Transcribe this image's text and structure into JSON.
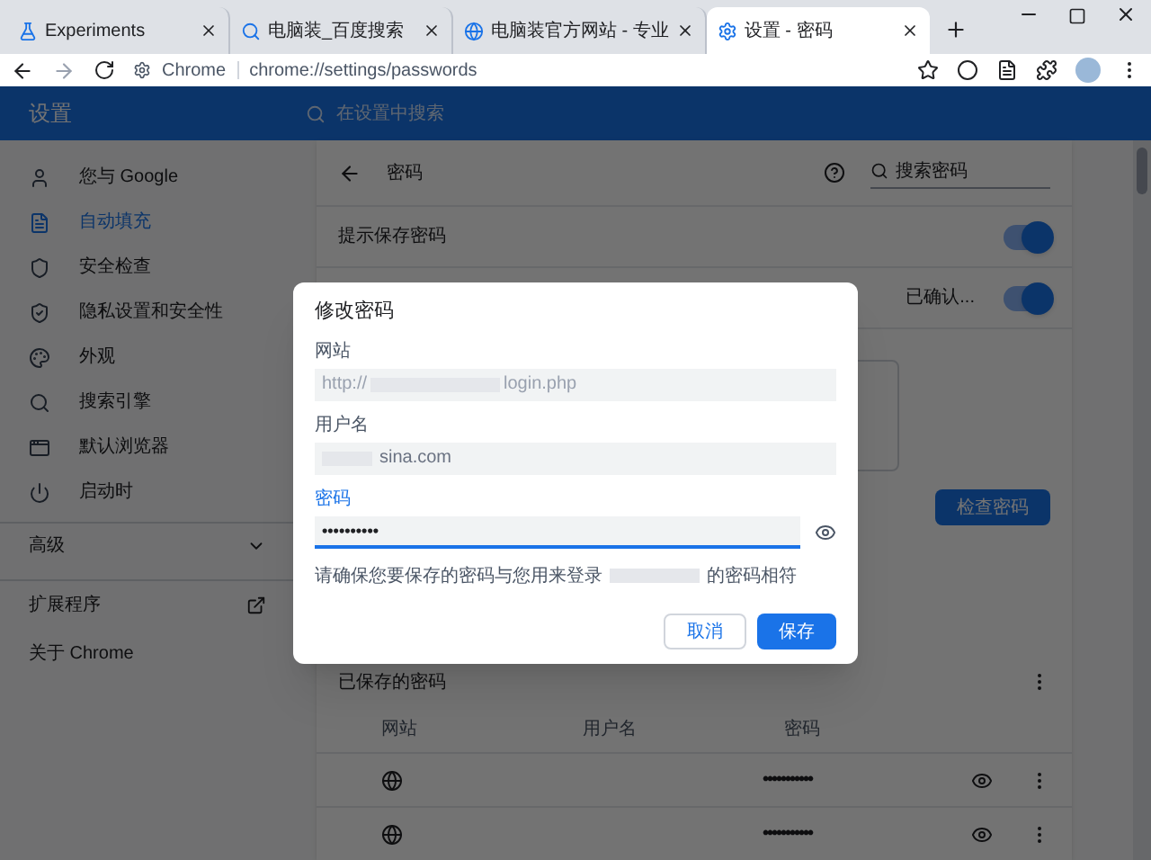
{
  "tabs": [
    {
      "title": "Experiments",
      "selected": false
    },
    {
      "title": "电脑装_百度搜索",
      "selected": false
    },
    {
      "title": "电脑装官方网站 - 专业",
      "selected": false
    },
    {
      "title": "设置 - 密码",
      "selected": true
    }
  ],
  "address_bar": {
    "origin": "Chrome",
    "url": "chrome://settings/passwords"
  },
  "header": {
    "title": "设置",
    "search_placeholder": "在设置中搜索"
  },
  "sidebar": {
    "items": [
      {
        "label": "您与 Google",
        "selected": false
      },
      {
        "label": "自动填充",
        "selected": true
      },
      {
        "label": "安全检查",
        "selected": false
      },
      {
        "label": "隐私设置和安全性",
        "selected": false
      },
      {
        "label": "外观",
        "selected": false
      },
      {
        "label": "搜索引擎",
        "selected": false
      },
      {
        "label": "默认浏览器",
        "selected": false
      },
      {
        "label": "启动时",
        "selected": false
      }
    ],
    "advanced": {
      "label": "高级",
      "expanded": false
    },
    "extensions": "扩展程序",
    "about": "关于 Chrome"
  },
  "passwords": {
    "title": "密码",
    "search_placeholder": "搜索密码",
    "settings": [
      {
        "label": "提示保存密码",
        "on": true
      },
      {
        "label": "已确认...",
        "on": true
      }
    ],
    "check_button": "检查密码",
    "saved_title": "已保存的密码",
    "columns": [
      "网站",
      "用户名",
      "密码"
    ],
    "rows": [
      {
        "password": "•••••••••••"
      },
      {
        "password": "•••••••••••"
      }
    ]
  },
  "dialog": {
    "title": "修改密码",
    "site": {
      "label": "网站",
      "value_start": "http://",
      "value_end": "login.php"
    },
    "username": {
      "label": "用户名",
      "value_end": "sina.com"
    },
    "password": {
      "label": "密码",
      "value": "••••••••••"
    },
    "note_start": "请确保您要保存的密码与您用来登录",
    "note_end": "的密码相符",
    "buttons": [
      "取消",
      "保存"
    ]
  }
}
